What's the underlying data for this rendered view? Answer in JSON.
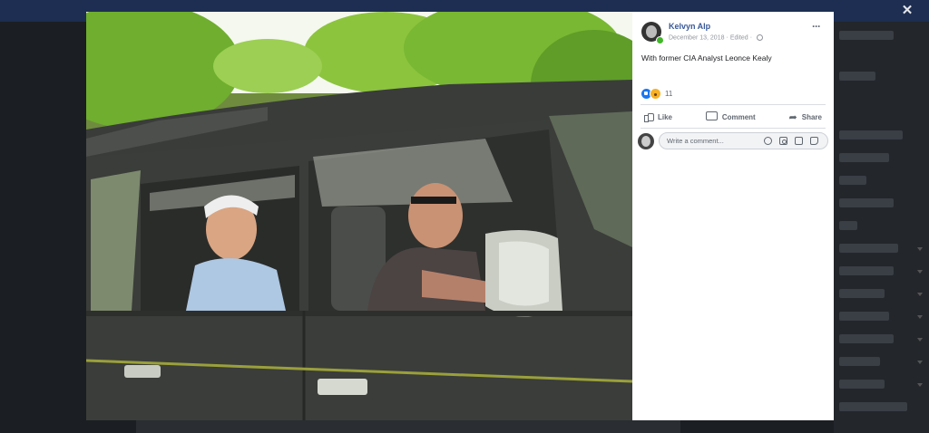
{
  "post": {
    "author": "Kelvyn Alp",
    "date": "December 13, 2018",
    "edited": "Edited",
    "separator": "·",
    "caption": "With former CIA Analyst Leonce Kealy",
    "more": "···",
    "reactions": {
      "count": "11",
      "types": [
        "like-icon",
        "wow-icon"
      ]
    }
  },
  "actions": {
    "like": "Like",
    "comment": "Comment",
    "share": "Share"
  },
  "comment_box": {
    "placeholder": "Write a comment..."
  },
  "viewer": {
    "close": "✕"
  },
  "colors": {
    "author_link": "#385898",
    "like_blue": "#1877f2",
    "wow_yellow": "#f7b125",
    "online_green": "#42b72a"
  }
}
